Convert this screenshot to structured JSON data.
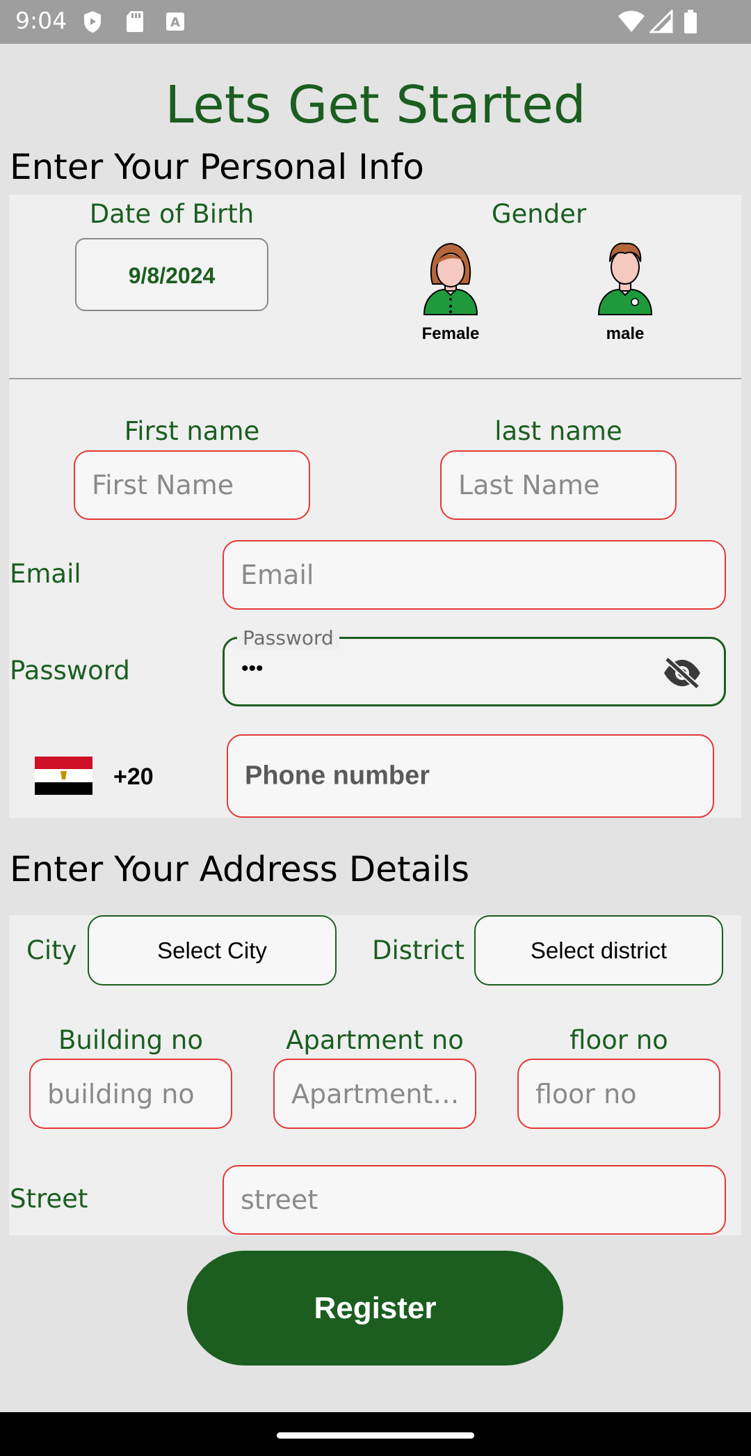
{
  "status_bar": {
    "time": "9:04"
  },
  "title": "Lets Get Started",
  "personal_section": {
    "heading": "Enter Your Personal Info",
    "dob_label": "Date of Birth",
    "dob_value": "9/8/2024",
    "gender_label": "Gender",
    "female_label": "Female",
    "male_label": "male",
    "first_name_label": "First name",
    "first_name_placeholder": "First Name",
    "last_name_label": "last name",
    "last_name_placeholder": "Last Name",
    "email_label": "Email",
    "email_placeholder": "Email",
    "password_label": "Password",
    "password_floating_label": "Password",
    "password_value": "•••",
    "country_code": "+20",
    "phone_placeholder": "Phone number"
  },
  "address_section": {
    "heading": "Enter Your Address Details",
    "city_label": "City",
    "city_button": "Select City",
    "district_label": "District",
    "district_button": "Select district",
    "building_label": "Building no",
    "building_placeholder": "building no",
    "apartment_label": "Apartment no",
    "apartment_placeholder": "Apartment no",
    "floor_label": "floor no",
    "floor_placeholder": "floor no",
    "street_label": "Street",
    "street_placeholder": "street"
  },
  "register_button": "Register",
  "colors": {
    "primary": "#1b5e20",
    "error_border": "#e53935",
    "status_bar": "#9e9e9e"
  },
  "icons": [
    "shield-icon",
    "sd-card-icon",
    "font-icon",
    "wifi-icon",
    "signal-icon",
    "battery-icon",
    "female-avatar-icon",
    "male-avatar-icon",
    "egypt-flag-icon",
    "visibility-off-icon"
  ]
}
